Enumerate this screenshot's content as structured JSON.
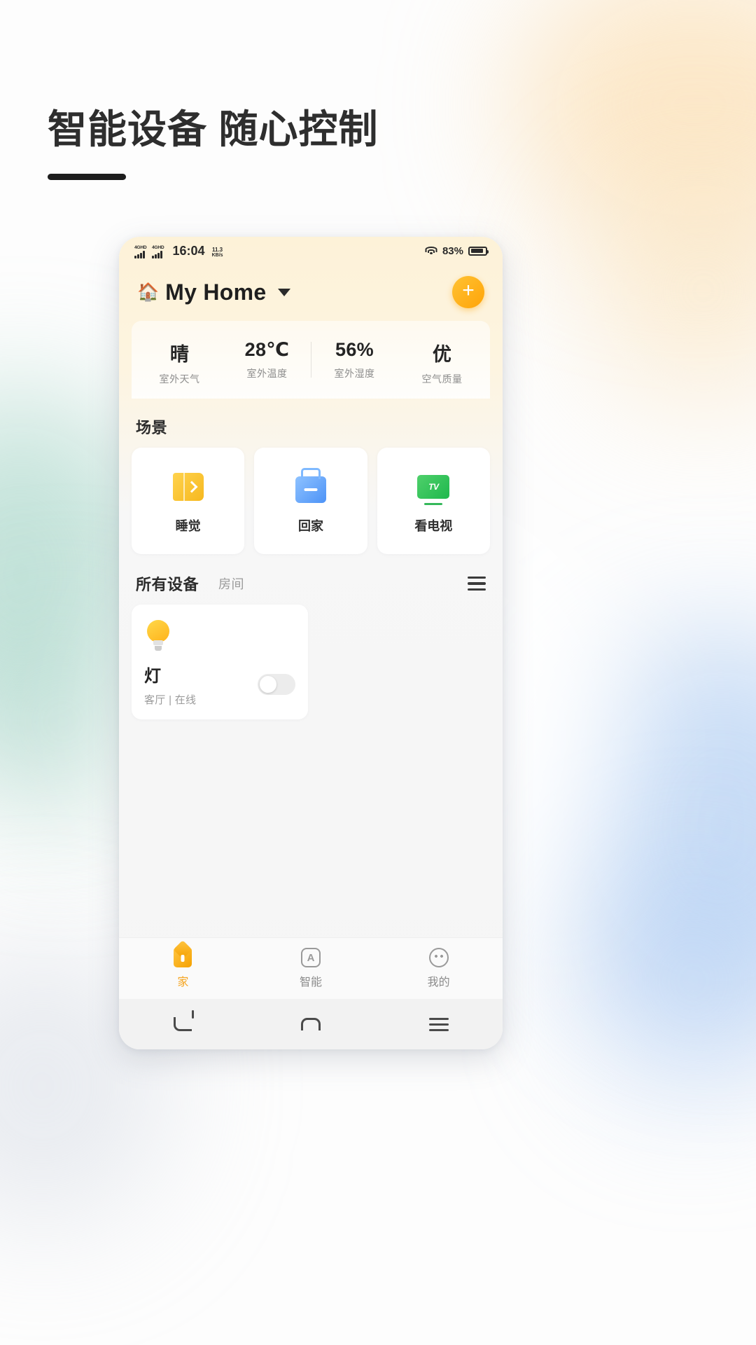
{
  "page": {
    "headline": "智能设备 随心控制"
  },
  "statusbar": {
    "sim1_label": "4G",
    "sim1_suffix": "HD",
    "sim2_label": "4G",
    "sim2_suffix": "HD",
    "time": "16:04",
    "netspeed_value": "11.3",
    "netspeed_unit": "KB/s",
    "bluetooth_icon": "bluetooth-icon",
    "wifi_icon": "wifi-icon",
    "battery_percent": "83%",
    "battery_icon": "battery-icon"
  },
  "appbar": {
    "home_icon": "home-icon",
    "title": "My Home",
    "dropdown_icon": "chevron-down-icon",
    "add_icon": "plus-icon",
    "add_label": "+"
  },
  "weather": {
    "cells": [
      {
        "value": "晴",
        "label": "室外天气"
      },
      {
        "value": "28℃",
        "label": "室外温度"
      },
      {
        "value": "56%",
        "label": "室外湿度"
      },
      {
        "value": "优",
        "label": "空气质量"
      }
    ]
  },
  "scenes": {
    "title": "场景",
    "items": [
      {
        "label": "睡觉",
        "icon": "sleep-book-icon",
        "color": "#f6b81f"
      },
      {
        "label": "回家",
        "icon": "briefcase-icon",
        "color": "#4d93f7"
      },
      {
        "label": "看电视",
        "icon": "tv-icon",
        "color": "#1fb84d",
        "icon_text": "TV"
      }
    ]
  },
  "devices": {
    "tab_all": "所有设备",
    "tab_rooms": "房间",
    "list_icon": "list-view-icon",
    "items": [
      {
        "name": "灯",
        "meta": "客厅 | 在线",
        "icon": "light-bulb-icon",
        "toggle_state": "off"
      }
    ]
  },
  "bottomnav": {
    "items": [
      {
        "label": "家",
        "icon": "home-filled-icon",
        "active": true
      },
      {
        "label": "智能",
        "icon": "automation-icon",
        "active": false
      },
      {
        "label": "我的",
        "icon": "profile-icon",
        "active": false
      }
    ]
  },
  "systembar": {
    "back_icon": "back-icon",
    "home_icon": "home-outline-icon",
    "recents_icon": "recents-icon"
  },
  "colors": {
    "accent": "#f5a623",
    "scene_yellow": "#f6b81f",
    "scene_blue": "#4d93f7",
    "scene_green": "#1fb84d"
  }
}
